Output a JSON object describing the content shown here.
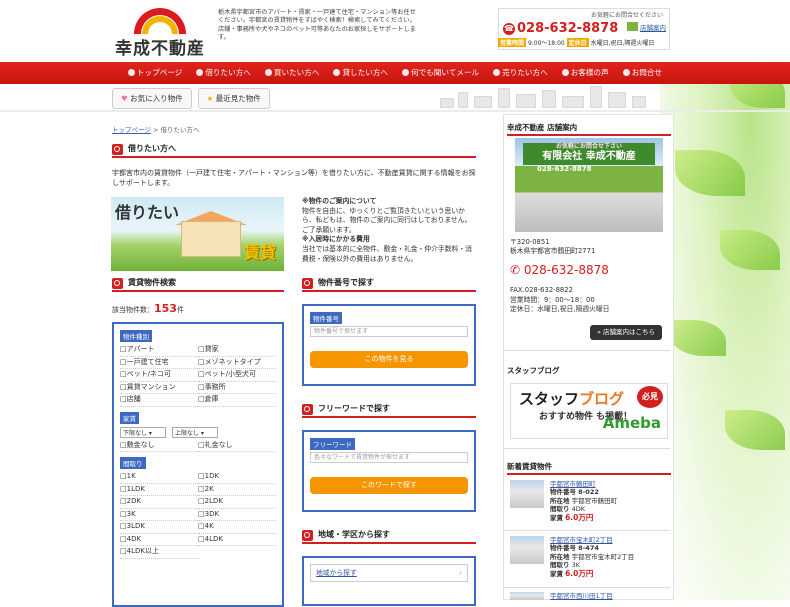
{
  "header": {
    "logo_text": "幸成不動産",
    "intro": "栃木県宇都宮市のアパート・賃家・一戸建て住宅・マンション等お任せください。宇都宮の賃貸物件をすばやく検索！検索してみてください。店舗・事務所や犬やネコのペット可等あなたのお家探しをサポートします。",
    "ask": "お気軽にお問合せください",
    "tel": "028-632-8878",
    "shop_link": "店舗案内",
    "hours_tag": "営業時間",
    "hours": "9:00～18:00",
    "closed_tag": "定休日",
    "closed": "水曜日,祝日,隔週火曜日"
  },
  "nav": {
    "items": [
      "トップページ",
      "借りたい方へ",
      "買いたい方へ",
      "貸したい方へ",
      "何でも聞いてメール",
      "売りたい方へ",
      "お客様の声",
      "お問合せ"
    ]
  },
  "subnav": {
    "favorites": "お気に入り物件",
    "recent": "最近見た物件"
  },
  "breadcrumb": {
    "home": "トップページ",
    "sep": ">",
    "current": "借りたい方へ"
  },
  "main": {
    "title": "借りたい方へ",
    "description": "宇都宮市内の賃貸物件（一戸建て住宅・アパート・マンション等）を借りたい方に、不動産賃貸に関する情報をお探しサポートします。",
    "banner_title": "借りたい",
    "banner_sub": "賃貸",
    "notes": [
      {
        "head": "※物件のご案内について",
        "body": "物件を自由に、ゆっくりとご覧頂きたいという思いから、私どもは、物件のご案内に同行はしておりません。ご了承願います。"
      },
      {
        "head": "※入居時にかかる費用",
        "body": "当社では基本的に全物件、敷金・礼金・仲介手数料・消費税・保険以外の費用はありません。"
      }
    ]
  },
  "search": {
    "title": "賃貸物件検索",
    "count_label": "該当物件数：",
    "count": "153",
    "count_unit": "件",
    "type_label": "物件種別",
    "types": [
      "アパート",
      "貸家",
      "一戸建て住宅",
      "メゾネットタイプ",
      "ペット/ネコ可",
      "ペット/小型犬可",
      "賃貸マンション",
      "事務所",
      "店舗",
      "倉庫"
    ],
    "rent_label": "家賃",
    "rent_min": "下限なし",
    "rent_max": "上限なし",
    "rent_opts": [
      "敷金なし",
      "礼金なし"
    ],
    "layout_label": "間取り",
    "layouts": [
      "1K",
      "1DK",
      "1LDK",
      "2K",
      "2DK",
      "2LDK",
      "3K",
      "3DK",
      "3LDK",
      "4K",
      "4DK",
      "4LDK",
      "4LDK以上"
    ]
  },
  "number_search": {
    "title": "物件番号で探す",
    "label": "物件番号",
    "placeholder": "物件番号で探せます",
    "button": "この物件を見る"
  },
  "free_search": {
    "title": "フリーワードで探す",
    "label": "フリーワード",
    "placeholder": "色々なワードで賃貸物件が探せます",
    "button": "このワードで探す"
  },
  "area_search": {
    "title": "地域・学区から探す",
    "link": "地域から探す"
  },
  "side": {
    "shop_title": "幸成不動産 店舗案内",
    "sign_small": "お気軽にお問合せ下さい",
    "sign_name": "有限会社 幸成不動産",
    "sign_tel": "028-632-8878",
    "zip": "〒320-0851",
    "address": "栃木県宇都宮市鶴田町2771",
    "tel": "028-632-8878",
    "fax": "FAX.028-632-8822",
    "hours": "営業時間：9：00～18：00",
    "closed": "定休日：水曜日,祝日,隔週火曜日",
    "shop_button": "» 店舗案内はこちら",
    "blog_title": "スタッフブログ",
    "blog_text1": "スタッフ",
    "blog_text2": "ブログ",
    "blog_badge": "必見",
    "blog_sub": "おすすめ物件 も掲載！",
    "blog_brand": "Ameba",
    "new_title": "新着賃貸物件",
    "listings": [
      {
        "title": "宇都宮市鶴田町",
        "no_label": "物件番号",
        "no": "8-022",
        "loc_label": "所在地",
        "loc": "宇都宮市鶴田町",
        "layout_label": "間取り",
        "layout": "4DK",
        "rent_label": "家賃",
        "rent": "6.0万円"
      },
      {
        "title": "宇都宮市宝木町2丁目",
        "no_label": "物件番号",
        "no": "8-474",
        "loc_label": "所在地",
        "loc": "宇都宮市宝木町2丁目",
        "layout_label": "間取り",
        "layout": "3K",
        "rent_label": "家賃",
        "rent": "6.0万円"
      },
      {
        "title": "宇都宮市西川田1丁目"
      }
    ]
  },
  "colors": {
    "accent_red": "#d21f1f",
    "search_blue": "#3d69c2",
    "button_orange": "#f59500"
  }
}
